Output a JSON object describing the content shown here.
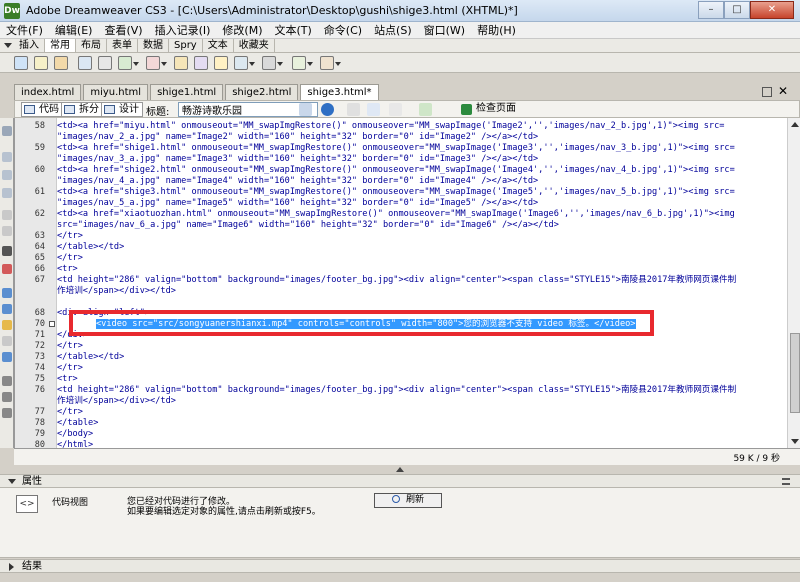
{
  "window": {
    "app_icon_text": "Dw",
    "title": "Adobe Dreamweaver CS3 - [C:\\Users\\Administrator\\Desktop\\gushi\\shige3.html (XHTML)*]",
    "controls": [
      "–",
      "□",
      "✕"
    ]
  },
  "menu": [
    "文件(F)",
    "编辑(E)",
    "查看(V)",
    "插入记录(I)",
    "修改(M)",
    "文本(T)",
    "命令(C)",
    "站点(S)",
    "窗口(W)",
    "帮助(H)"
  ],
  "insert_bar": {
    "tabs": [
      "插入",
      "常用",
      "布局",
      "表单",
      "数据",
      "Spry",
      "文本",
      "收藏夹"
    ],
    "active": "常用"
  },
  "toolbar_icons": [
    "hyperlink-icon",
    "email-link-icon",
    "named-anchor-icon",
    "table-icon",
    "insert-div-icon",
    "image-icon",
    "media-icon",
    "date-icon",
    "server-side-include-icon",
    "comment-icon",
    "head-icon",
    "script-icon",
    "templates-icon",
    "tag-chooser-icon"
  ],
  "document_tabs": [
    "index.html",
    "miyu.html",
    "shige1.html",
    "shige2.html",
    "shige3.html*"
  ],
  "active_document": "shige3.html*",
  "doc_toolbar": {
    "code_button": "代码",
    "split_button": "拆分",
    "design_button": "设计",
    "title_label": "标题:",
    "title_value": "畅游诗歌乐园",
    "preview_button": "检查页面"
  },
  "code_lines": [
    {
      "num": "58",
      "text": "            <td><a href=\"miyu.html\" onmouseout=\"MM_swapImgRestore()\" onmouseover=\"MM_swapImage('Image2','','images/nav_2_b.jpg',1)\"><img src="
    },
    {
      "num": "",
      "text": "\"images/nav_2_a.jpg\" name=\"Image2\" width=\"160\" height=\"32\" border=\"0\" id=\"Image2\" /></a></td>"
    },
    {
      "num": "59",
      "text": "            <td><a href=\"shige1.html\" onmouseout=\"MM_swapImgRestore()\" onmouseover=\"MM_swapImage('Image3','','images/nav_3_b.jpg',1)\"><img src="
    },
    {
      "num": "",
      "text": "\"images/nav_3_a.jpg\" name=\"Image3\" width=\"160\" height=\"32\" border=\"0\" id=\"Image3\" /></a></td>"
    },
    {
      "num": "60",
      "text": "            <td><a href=\"shige2.html\" onmouseout=\"MM_swapImgRestore()\" onmouseover=\"MM_swapImage('Image4','','images/nav_4_b.jpg',1)\"><img src="
    },
    {
      "num": "",
      "text": "\"images/nav_4_a.jpg\" name=\"Image4\" width=\"160\" height=\"32\" border=\"0\" id=\"Image4\" /></a></td>"
    },
    {
      "num": "61",
      "text": "            <td><a href=\"shige3.html\" onmouseout=\"MM_swapImgRestore()\" onmouseover=\"MM_swapImage('Image5','','images/nav_5_b.jpg',1)\"><img src="
    },
    {
      "num": "",
      "text": "\"images/nav_5_a.jpg\" name=\"Image5\" width=\"160\" height=\"32\" border=\"0\" id=\"Image5\" /></a></td>"
    },
    {
      "num": "62",
      "text": "            <td><a href=\"xiaotuozhan.html\" onmouseout=\"MM_swapImgRestore()\" onmouseover=\"MM_swapImage('Image6','','images/nav_6_b.jpg',1)\"><img"
    },
    {
      "num": "",
      "text": "src=\"images/nav_6_a.jpg\" name=\"Image6\" width=\"160\" height=\"32\" border=\"0\" id=\"Image6\" /></a></td>"
    },
    {
      "num": "63",
      "text": "          </tr>"
    },
    {
      "num": "64",
      "text": "        </table></td>"
    },
    {
      "num": "65",
      "text": "      </tr>"
    },
    {
      "num": "66",
      "text": "      <tr>"
    },
    {
      "num": "67",
      "text": "        <td height=\"286\" valign=\"bottom\" background=\"images/footer_bg.jpg\"><div align=\"center\"><span class=\"STYLE15\">南陵县2017年教师网页课件制"
    },
    {
      "num": "",
      "text": "作培训</span></div></td>"
    },
    {
      "num": "68",
      "text": "          <div align=\"left\">"
    },
    {
      "num": "70",
      "text": "<video src=\"src/songyuanershianxi.mp4\" controls=\"controls\" width=\"800\">您的浏览器不支持 video 标签。</video>"
    },
    {
      "num": "71",
      "text": "</div>"
    },
    {
      "num": "72",
      "text": "          </tr>"
    },
    {
      "num": "73",
      "text": "        </table></td>"
    },
    {
      "num": "74",
      "text": "      </tr>"
    },
    {
      "num": "75",
      "text": "      <tr>"
    },
    {
      "num": "76",
      "text": "        <td height=\"286\" valign=\"bottom\" background=\"images/footer_bg.jpg\"><div align=\"center\"><span class=\"STYLE15\">南陵县2017年教师网页课件制"
    },
    {
      "num": "",
      "text": "作培训</span></div></td>"
    },
    {
      "num": "77",
      "text": "      </tr>"
    },
    {
      "num": "78",
      "text": "    </table>"
    },
    {
      "num": "79",
      "text": "  </body>"
    },
    {
      "num": "80",
      "text": "</html>"
    }
  ],
  "selected_line": "70",
  "status": "59 K / 9 秒",
  "properties": {
    "title": "属性",
    "view_label": "代码视图",
    "message_line1": "您已经对代码进行了修改。",
    "message_line2": "如果要编辑选定对象的属性,请点击刷新或按F5。",
    "refresh_button": "刷新"
  },
  "results_title": "结果",
  "colors": {
    "highlight_border": "#e8292e",
    "selection": "#3399ff",
    "code_text": "#000099"
  }
}
